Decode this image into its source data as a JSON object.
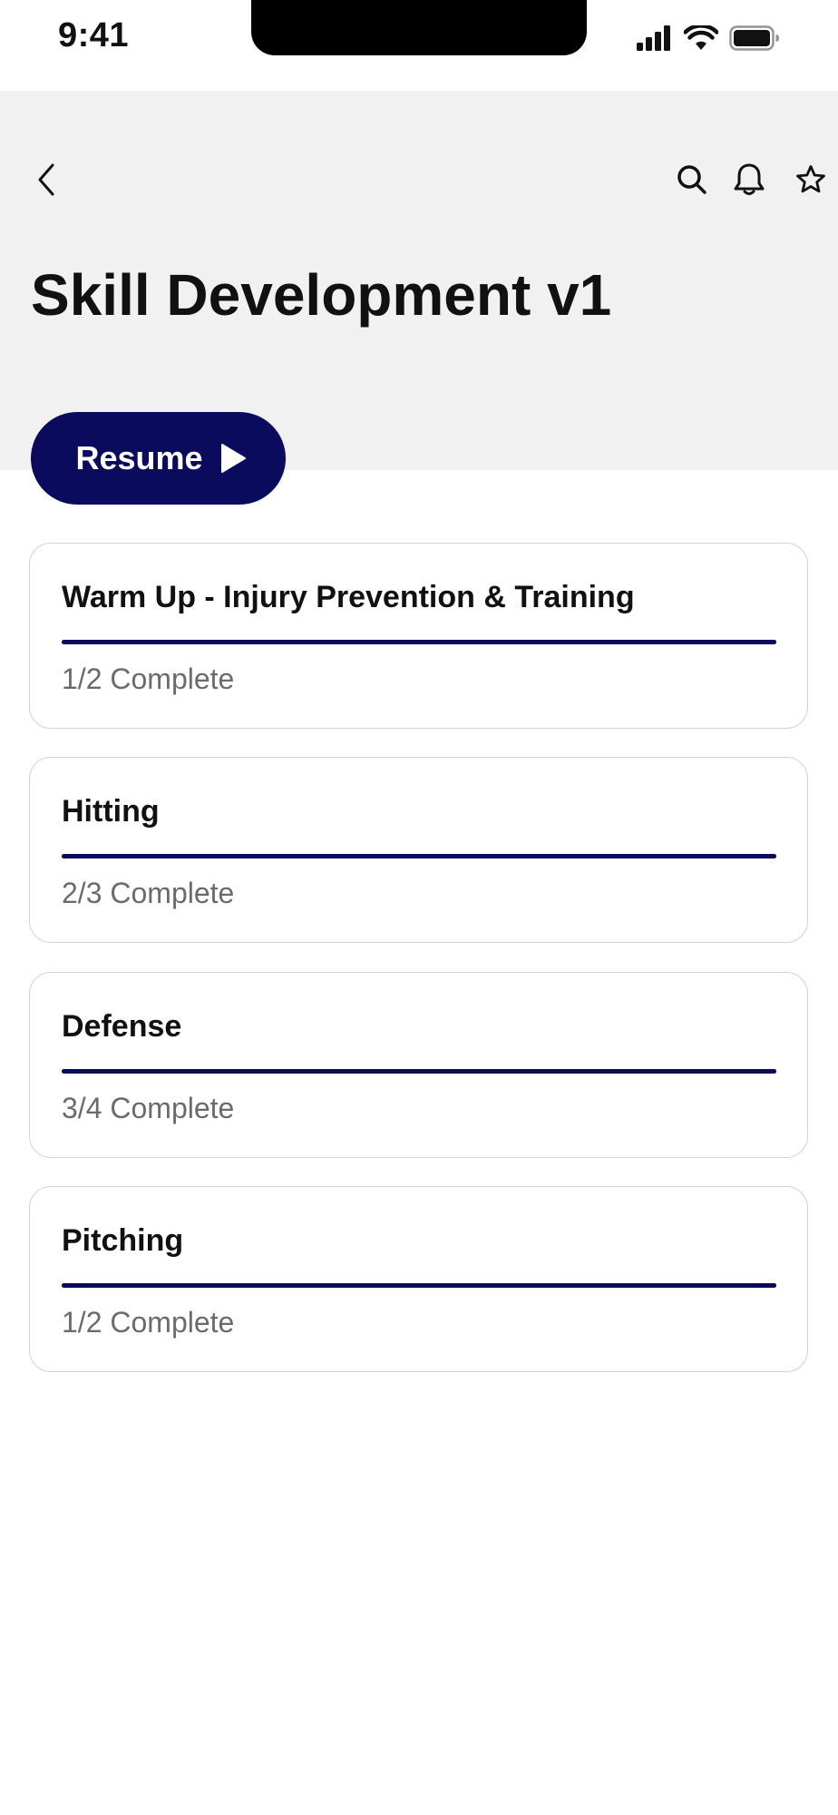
{
  "status_bar": {
    "time": "9:41",
    "icons": [
      "signal-icon",
      "wifi-icon",
      "battery-icon"
    ]
  },
  "header": {
    "back_icon": "chevron-left-icon",
    "action_icons": [
      "search-icon",
      "bell-icon",
      "star-icon"
    ],
    "title": "Skill Development v1"
  },
  "resume": {
    "label": "Resume",
    "icon": "play-icon"
  },
  "modules": [
    {
      "title": "Warm Up - Injury Prevention & Training",
      "status": "1/2 Complete",
      "progress": 1.0
    },
    {
      "title": "Hitting",
      "status": "2/3 Complete",
      "progress": 1.0
    },
    {
      "title": "Defense",
      "status": "3/4 Complete",
      "progress": 1.0
    },
    {
      "title": "Pitching",
      "status": "1/2 Complete",
      "progress": 1.0
    }
  ],
  "colors": {
    "accent": "#0b0b5e",
    "header_bg": "#f1f1f1",
    "muted_text": "#6b6b6b",
    "card_border": "#d2d2d2"
  }
}
